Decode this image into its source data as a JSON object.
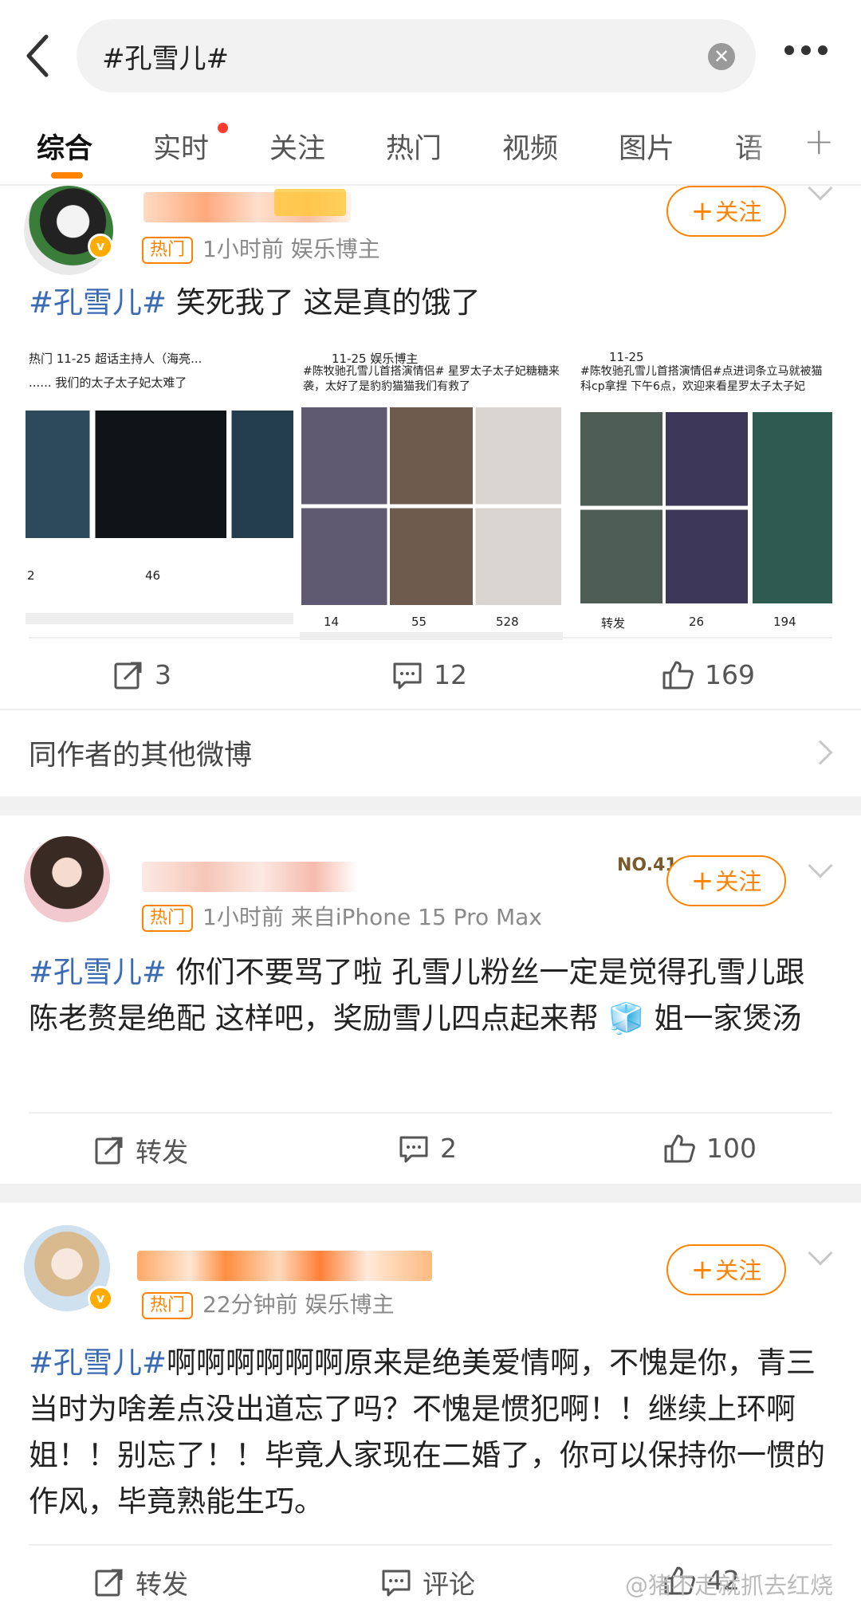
{
  "search": {
    "query": "#孔雪儿#",
    "clear_label": "✕"
  },
  "tabs": [
    {
      "label": "综合"
    },
    {
      "label": "实时"
    },
    {
      "label": "关注"
    },
    {
      "label": "热门"
    },
    {
      "label": "视频"
    },
    {
      "label": "图片"
    },
    {
      "label": "语"
    },
    {
      "label": "+"
    }
  ],
  "posts": [
    {
      "hot_badge": "热门",
      "meta": "1小时前  娱乐博主",
      "follow_label": "关注",
      "tag": "#孔雪儿#",
      "text": " 笑死我了 这是真的饿了",
      "actions": {
        "repost": "3",
        "comment": "12",
        "like": "169"
      },
      "embedded": [
        {
          "header": "热门  11-25  超话主持人（海亮...",
          "caption": "...... 我们的太子太子妃太难了",
          "stats": [
            "2",
            "46",
            ""
          ]
        },
        {
          "header": "11-25  娱乐博主",
          "caption": "#陈牧驰孔雪儿首搭演情侣# 星罗太子太子妃糖糖来袭，太好了是豹豹猫猫我们有救了",
          "stats": [
            "14",
            "55",
            "528"
          ]
        },
        {
          "header": "11-25",
          "caption": "#陈牧驰孔雪儿首搭演情侣#点进词条立马就被猫科cp拿捏 下午6点，欢迎来看星罗太子太子妃",
          "stats": [
            "转发",
            "26",
            "194"
          ]
        }
      ]
    },
    {
      "hot_badge": "热门",
      "meta": "1小时前  来自iPhone 15 Pro Max",
      "follow_label": "关注",
      "rank": "NO.41",
      "tag": "#孔雪儿#",
      "text": " 你们不要骂了啦 孔雪儿粉丝一定是觉得孔雪儿跟陈老赘是绝配 这样吧，奖励雪儿四点起来帮 🧊 姐一家煲汤",
      "actions": {
        "repost": "转发",
        "comment": "2",
        "like": "100"
      }
    },
    {
      "hot_badge": "热门",
      "meta": "22分钟前  娱乐博主",
      "follow_label": "关注",
      "tag": "#孔雪儿#",
      "text": "啊啊啊啊啊啊原来是绝美爱情啊，不愧是你，青三当时为啥差点没出道忘了吗？不愧是惯犯啊！！继续上环啊姐！！别忘了！！毕竟人家现在二婚了，你可以保持你一惯的作风，毕竟熟能生巧。",
      "actions": {
        "repost": "转发",
        "comment": "评论",
        "like": "42"
      }
    }
  ],
  "other_from_author": "同作者的其他微博",
  "watermark": "@猪不走就抓去红烧",
  "colors": {
    "accent": "#ff8200",
    "tag": "#3b6bb3",
    "separator": "#f1f1f1"
  }
}
